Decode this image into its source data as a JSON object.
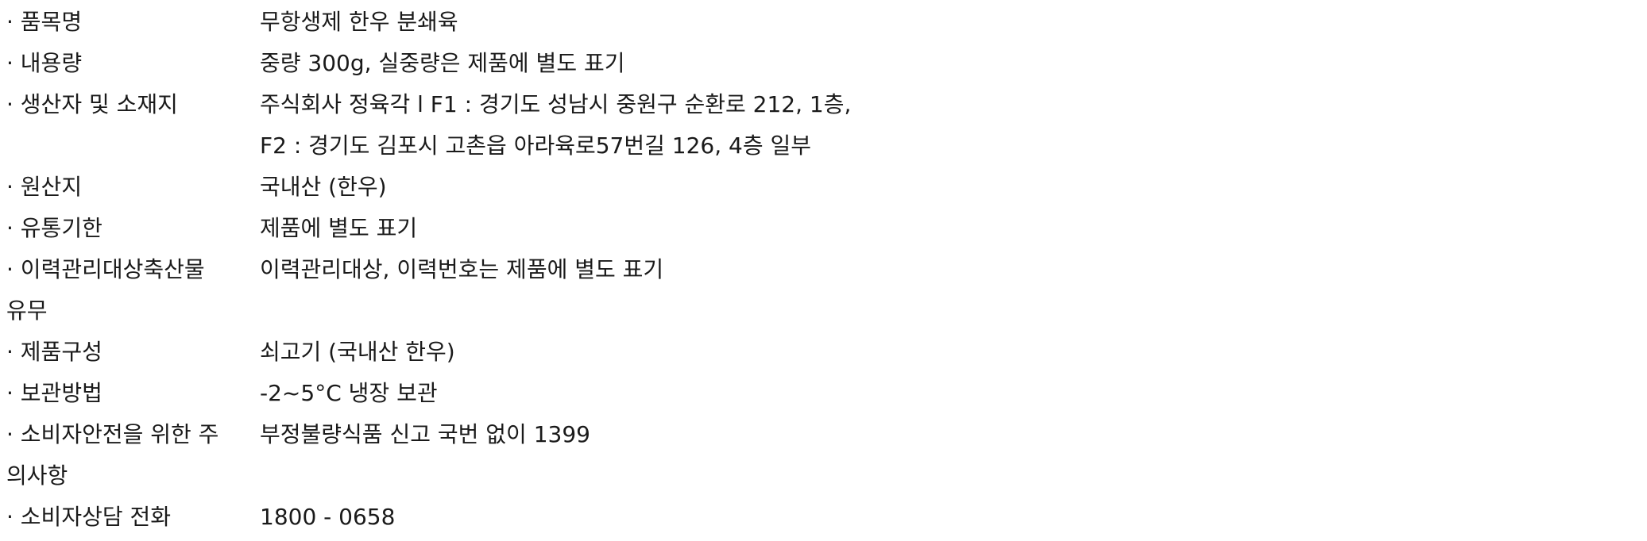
{
  "spec": {
    "rows": [
      {
        "label": "· 품목명",
        "value": "무항생제 한우 분쇄육"
      },
      {
        "label": "· 내용량",
        "value": "중량 300g, 실중량은 제품에 별도 표기"
      },
      {
        "label": "· 생산자 및 소재지",
        "value": "주식회사 정육각 l F1 : 경기도 성남시 중원구 순환로 212, 1층,",
        "value_line2": "F2 : 경기도 김포시 고촌읍 아라육로57번길 126, 4층 일부"
      },
      {
        "label": "· 원산지",
        "value": "국내산 (한우)"
      },
      {
        "label": "· 유통기한",
        "value": "제품에 별도 표기"
      },
      {
        "label": "· 이력관리대상축산물",
        "label_wrap": "유무",
        "value": "이력관리대상, 이력번호는 제품에 별도 표기"
      },
      {
        "label": "· 제품구성",
        "value": "쇠고기 (국내산 한우)"
      },
      {
        "label": "· 보관방법",
        "value": "-2~5°C 냉장 보관"
      },
      {
        "label": "· 소비자안전을 위한 주",
        "label_wrap": "의사항",
        "value": "부정불량식품 신고 국번 없이 1399"
      },
      {
        "label": "· 소비자상담 전화",
        "value": "1800 - 0658"
      }
    ]
  }
}
